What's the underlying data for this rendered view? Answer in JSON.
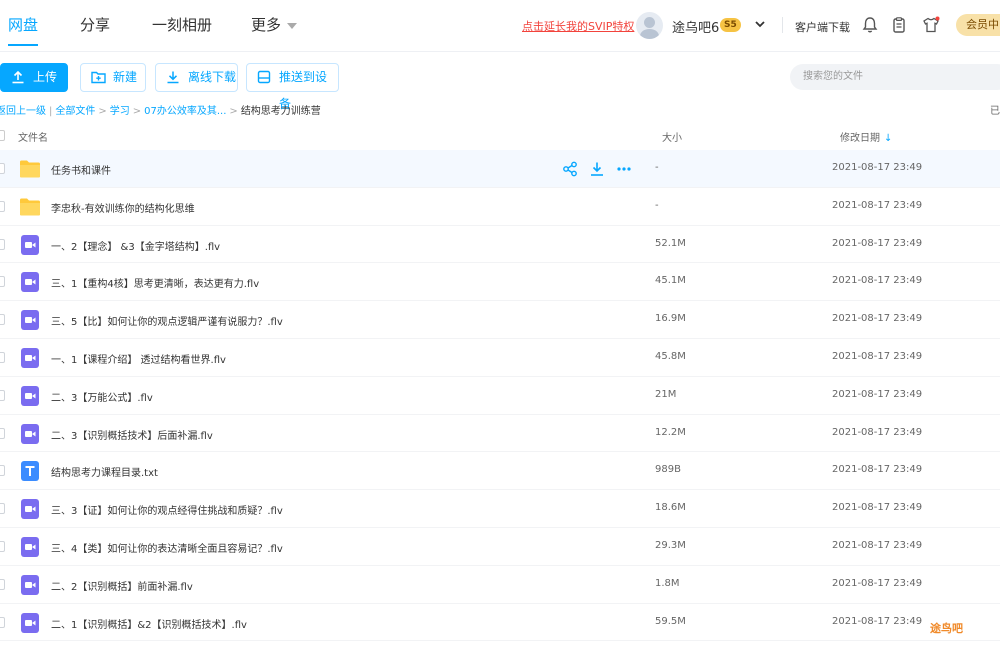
{
  "nav": {
    "tabs": [
      {
        "label": "网盘"
      },
      {
        "label": "分享"
      },
      {
        "label": "一刻相册"
      },
      {
        "label": "更多"
      }
    ],
    "svip_link": "点击延长我的SVIP特权",
    "username": "途乌吧6",
    "vip_level": "5",
    "client_download": "客户端下载",
    "vip_center": "会员中"
  },
  "toolbar": {
    "upload": "上传",
    "new": "新建",
    "offline": "离线下载",
    "push": "推送到设备",
    "search_placeholder": "搜索您的文件"
  },
  "breadcrumb": {
    "back": "返回上一级",
    "items": [
      "全部文件",
      "学习",
      "07办公效率及其..."
    ],
    "current": "结构思考力训练营",
    "right_edge": "已"
  },
  "table": {
    "col_name": "文件名",
    "col_size": "大小",
    "col_date": "修改日期",
    "rows": [
      {
        "type": "folder",
        "name": "任务书和课件",
        "size": "-",
        "date": "2021-08-17 23:49"
      },
      {
        "type": "folder",
        "name": "李忠秋-有效训练你的结构化思维",
        "size": "-",
        "date": "2021-08-17 23:49"
      },
      {
        "type": "video",
        "name": "一、2【理念】 &3【金字塔结构】.flv",
        "size": "52.1M",
        "date": "2021-08-17 23:49"
      },
      {
        "type": "video",
        "name": "三、1【重构4核】思考更清晰，表达更有力.flv",
        "size": "45.1M",
        "date": "2021-08-17 23:49"
      },
      {
        "type": "video",
        "name": "三、5【比】如何让你的观点逻辑严谨有说服力？.flv",
        "size": "16.9M",
        "date": "2021-08-17 23:49"
      },
      {
        "type": "video",
        "name": "一、1【课程介绍】 透过结构看世界.flv",
        "size": "45.8M",
        "date": "2021-08-17 23:49"
      },
      {
        "type": "video",
        "name": "二、3【万能公式】.flv",
        "size": "21M",
        "date": "2021-08-17 23:49"
      },
      {
        "type": "video",
        "name": "二、3【识别概括技术】后面补漏.flv",
        "size": "12.2M",
        "date": "2021-08-17 23:49"
      },
      {
        "type": "text",
        "name": "结构思考力课程目录.txt",
        "size": "989B",
        "date": "2021-08-17 23:49"
      },
      {
        "type": "video",
        "name": "三、3【证】如何让你的观点经得住挑战和质疑？.flv",
        "size": "18.6M",
        "date": "2021-08-17 23:49"
      },
      {
        "type": "video",
        "name": "三、4【类】如何让你的表达清晰全面且容易记？.flv",
        "size": "29.3M",
        "date": "2021-08-17 23:49"
      },
      {
        "type": "video",
        "name": "二、2【识别概括】前面补漏.flv",
        "size": "1.8M",
        "date": "2021-08-17 23:49"
      },
      {
        "type": "video",
        "name": "二、1【识别概括】&2【识别概括技术】.flv",
        "size": "59.5M",
        "date": "2021-08-17 23:49"
      }
    ]
  },
  "watermark": "途鸟吧",
  "colors": {
    "accent": "#06a7ff",
    "folder": "#ffc93b",
    "video": "#7a6cf0",
    "text": "#3b8cff"
  }
}
